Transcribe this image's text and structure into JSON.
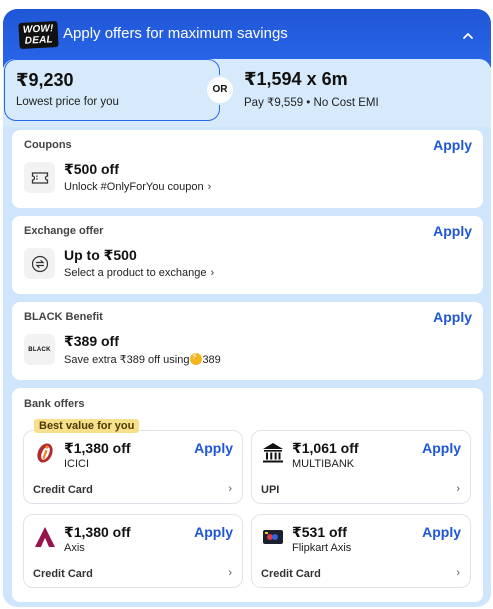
{
  "header": {
    "logo_line1": "WOW!",
    "logo_line2": "DEAL",
    "title": "Apply offers for maximum savings"
  },
  "pricing": {
    "lowest_price": "₹9,230",
    "lowest_label": "Lowest price for you",
    "or_label": "OR",
    "emi_price": "₹1,594 x 6m",
    "emi_note": "Pay ₹9,559 • No Cost EMI"
  },
  "coupons": {
    "title": "Coupons",
    "apply": "Apply",
    "amount": "₹500 off",
    "detail": "Unlock #OnlyForYou coupon",
    "icon": "ticket-icon"
  },
  "exchange": {
    "title": "Exchange offer",
    "apply": "Apply",
    "amount": "Up to ₹500",
    "detail": "Select a product to exchange",
    "icon": "exchange-icon"
  },
  "black": {
    "title": "BLACK Benefit",
    "apply": "Apply",
    "amount": "₹389 off",
    "detail": "Save extra ₹389 off using",
    "coin_value": "389",
    "logo_text": "BLACK"
  },
  "bank": {
    "title": "Bank offers",
    "best_tag": "Best value for you",
    "offers": [
      {
        "amount": "₹1,380 off",
        "bank": "ICICI",
        "type": "Credit Card",
        "apply": "Apply",
        "icon": "icici-logo-icon"
      },
      {
        "amount": "₹1,061 off",
        "bank": "MULTIBANK",
        "type": "UPI",
        "apply": "Apply",
        "icon": "bank-building-icon"
      },
      {
        "amount": "₹1,380 off",
        "bank": "Axis",
        "type": "Credit Card",
        "apply": "Apply",
        "icon": "axis-logo-icon"
      },
      {
        "amount": "₹531 off",
        "bank": "Flipkart Axis",
        "type": "Credit Card",
        "apply": "Apply",
        "icon": "flipkart-axis-card-icon"
      }
    ]
  },
  "colors": {
    "accent": "#1f56d6",
    "panel_bg": "#cfe5fb",
    "best_tag_bg": "#f8e08a",
    "coin": "#f3b51f"
  }
}
